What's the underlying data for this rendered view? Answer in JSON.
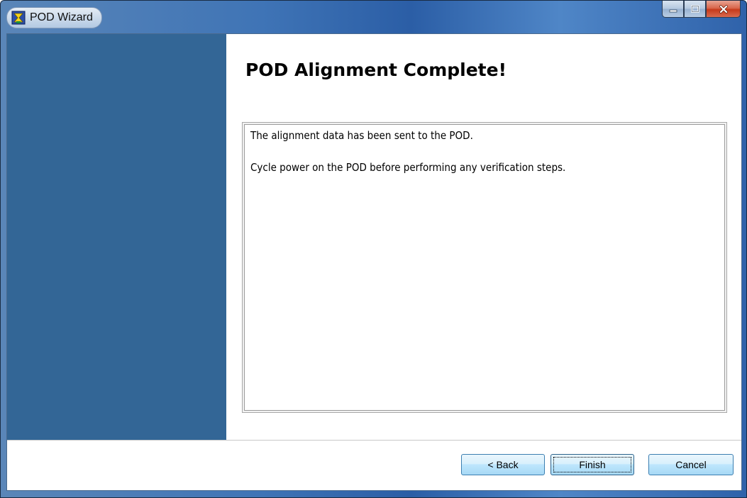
{
  "window": {
    "title": "POD Wizard",
    "icon": "pod-wizard-app-icon"
  },
  "caption": {
    "minimize": "minimize-icon",
    "maximize": "maximize-icon",
    "close": "close-icon"
  },
  "page": {
    "heading": "POD Alignment Complete!",
    "message_lines": [
      "The alignment data has been sent to the POD.",
      "Cycle power on the POD before performing any verification steps."
    ]
  },
  "buttons": {
    "back_label": "< Back",
    "finish_label": "Finish",
    "cancel_label": "Cancel"
  },
  "colors": {
    "sidebar": "#336696",
    "accent": "#3c7fb1",
    "close": "#c63a1b"
  }
}
